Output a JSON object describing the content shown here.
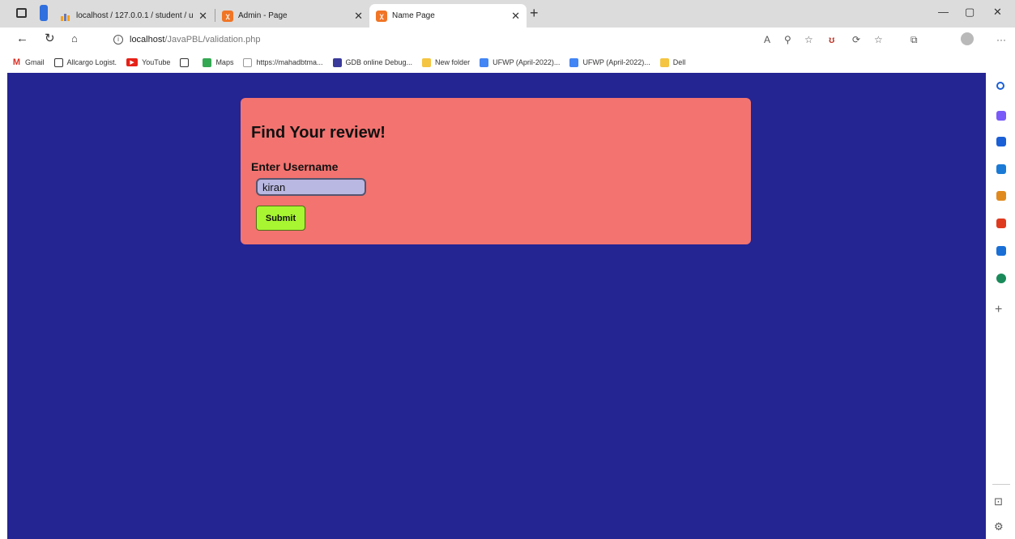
{
  "browser": {
    "tabs": [
      {
        "title": "localhost / 127.0.0.1 / student / u",
        "active": false
      },
      {
        "title": "Admin - Page",
        "active": false
      },
      {
        "title": "Name Page",
        "active": true
      }
    ],
    "address": {
      "host": "localhost",
      "path": "/JavaPBL/validation.php"
    },
    "bookmarks": [
      {
        "label": "Gmail"
      },
      {
        "label": "Allcargo Logist."
      },
      {
        "label": "YouTube"
      },
      {
        "label": ""
      },
      {
        "label": "Maps"
      },
      {
        "label": "https://mahadbtma..."
      },
      {
        "label": "GDB online Debug..."
      },
      {
        "label": "New folder"
      },
      {
        "label": "UFWP (April-2022)..."
      },
      {
        "label": "UFWP (April-2022)..."
      },
      {
        "label": "Dell"
      }
    ]
  },
  "page": {
    "heading": "Find Your review!",
    "username_label": "Enter Username",
    "username_value": "kiran",
    "submit_label": "Submit",
    "background_color": "#242493",
    "card_color": "#f27370",
    "submit_color": "#a8f532"
  }
}
